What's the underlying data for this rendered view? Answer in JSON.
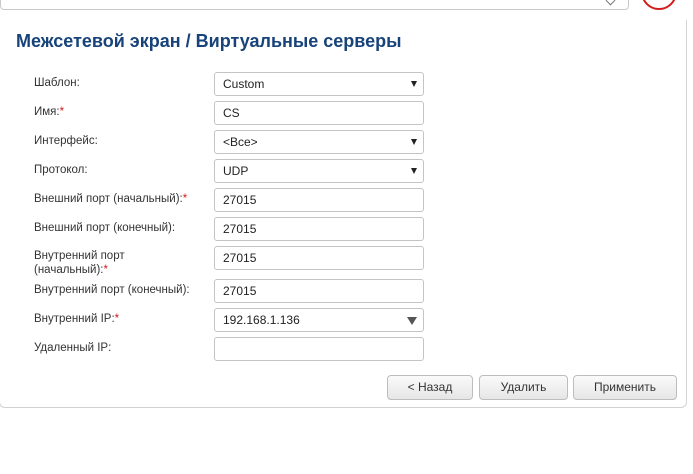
{
  "header": {
    "section": "Межсетевой экран /",
    "page": "Виртуальные серверы"
  },
  "form": {
    "template": {
      "label": "Шаблон:",
      "value": "Custom"
    },
    "name": {
      "label": "Имя:",
      "required_mark": "*",
      "value": "CS"
    },
    "interface": {
      "label": "Интерфейс:",
      "value": "<Все>"
    },
    "protocol": {
      "label": "Протокол:",
      "value": "UDP"
    },
    "ext_port_start": {
      "label": "Внешний порт (начальный):",
      "required_mark": "*",
      "value": "27015"
    },
    "ext_port_end": {
      "label": "Внешний порт (конечный):",
      "value": "27015"
    },
    "int_port_start": {
      "label_line1": "Внутренний порт",
      "label_line2": "(начальный):",
      "required_mark": "*",
      "value": "27015"
    },
    "int_port_end": {
      "label": "Внутренний порт (конечный):",
      "value": "27015"
    },
    "internal_ip": {
      "label": "Внутренний IP:",
      "required_mark": "*",
      "value": "192.168.1.136"
    },
    "remote_ip": {
      "label": "Удаленный IP:",
      "value": ""
    }
  },
  "buttons": {
    "back": "< Назад",
    "delete": "Удалить",
    "apply": "Применить"
  },
  "colors": {
    "title": "#17437a",
    "required": "#d31c1c"
  }
}
